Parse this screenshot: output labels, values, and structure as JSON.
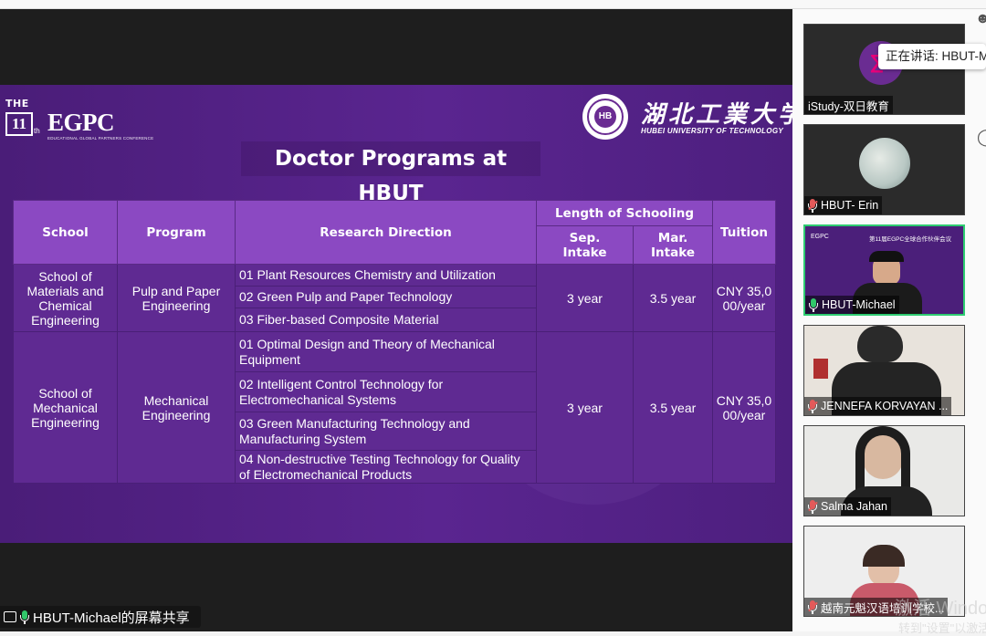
{
  "slide": {
    "event_prefix": "THE",
    "event_edition": "11",
    "event_edition_suffix": "th",
    "event_name": "EGPC",
    "event_subtitle": "EDUCATIONAL GLOBAL PARTNERS CONFERENCE",
    "university_cn": "湖北工業大学",
    "university_en": "HUBEI UNIVERSITY OF TECHNOLOGY",
    "title": "Doctor Programs at HBUT",
    "table": {
      "headers": {
        "school": "School",
        "program": "Program",
        "research_direction": "Research Direction",
        "length_group": "Length of Schooling",
        "sep_intake": "Sep. Intake",
        "mar_intake": "Mar. Intake",
        "tuition": "Tuition"
      },
      "groups": [
        {
          "school": "School of Materials and Chemical Engineering",
          "program": "Pulp and Paper Engineering",
          "directions": [
            "01 Plant Resources Chemistry and Utilization",
            "02 Green Pulp and Paper Technology",
            "03 Fiber-based Composite Material"
          ],
          "sep": "3 year",
          "mar": "3.5 year",
          "tuition": "CNY 35,000/year"
        },
        {
          "school": "School of Mechanical Engineering",
          "program": "Mechanical Engineering",
          "directions": [
            "01 Optimal Design and Theory of Mechanical Equipment",
            "02 Intelligent Control Technology for Electromechanical Systems",
            "03 Green Manufacturing Technology and Manufacturing System",
            "04 Non-destructive Testing Technology for Quality of Electromechanical Products"
          ],
          "sep": "3 year",
          "mar": "3.5 year",
          "tuition": "CNY 35,000/year"
        }
      ]
    }
  },
  "share_label": "HBUT-Michael的屏幕共享",
  "speaking_banner": "正在讲话: HBUT-Michael",
  "participants": [
    {
      "name": "iStudy-双日教育",
      "mic": "none"
    },
    {
      "name": "HBUT- Erin",
      "mic": "muted"
    },
    {
      "name": "HBUT-Michael",
      "mic": "active",
      "slide_text": "第11届EGPC全球合作伙伴会议"
    },
    {
      "name": "JENNEFA KORVAYAN ...",
      "mic": "muted"
    },
    {
      "name": "Salma Jahan",
      "mic": "muted"
    },
    {
      "name": "越南元魁汉语培训学校...",
      "mic": "muted"
    }
  ],
  "watermark": "激活 Windows",
  "watermark_sub": "转到\"设置\"以激活",
  "colors": {
    "slide_bg": "#5a2590",
    "header_bg": "#8b49c2",
    "cell_bg": "#5f2a92",
    "active_speaker": "#2ecc71"
  },
  "icons": [
    "microphone-icon",
    "muted-microphone-icon",
    "screen-share-icon",
    "person-icon",
    "chat-icon"
  ]
}
